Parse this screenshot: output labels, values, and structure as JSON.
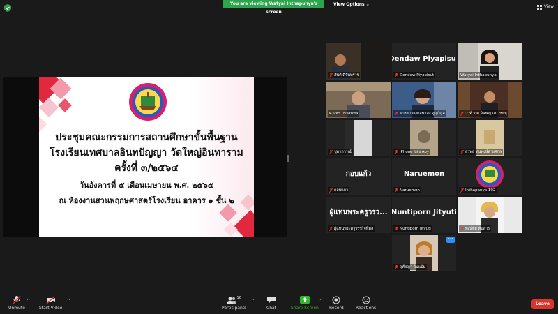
{
  "topbar": {
    "banner": "You are viewing Watyai Inthapunya's screen",
    "view_options": "View Options",
    "view": "View"
  },
  "slide": {
    "line1": "ประชุมคณะกรรมการสถานศึกษาขั้นพื้นฐาน",
    "line2": "โรงเรียนเทศบาลอินทปัญญา วัดใหญ่อินทาราม",
    "line3": "ครั้งที่  ๓/๒๕๖๔",
    "line4": "วันอังคารที่ ๕ เดือนเมษายน พ.ศ. ๒๕๖๕",
    "line5": "ณ ห้องงานสวนพฤกษศาสตร์โรงเรียน อาคาร ๑ ชั้น ๒"
  },
  "participants": [
    {
      "label": "สันติ ดีจันทร์ไร",
      "big": ""
    },
    {
      "label": "Dendaw Piyapisut",
      "big": "Dendaw Piyapisut"
    },
    {
      "label": "Watyai Inthapunya",
      "big": ""
    },
    {
      "label": "ดวงพร กราสนทพ",
      "big": ""
    },
    {
      "label": "นางสาวจงกลนาสะ สูญวิภูล",
      "big": ""
    },
    {
      "label": "ว่าที่ ร.ต.ดิษพญ แนวชยมุ",
      "big": ""
    },
    {
      "label": "ชุดาการณ์",
      "big": ""
    },
    {
      "label": "iPhone ของ Aoy",
      "big": ""
    },
    {
      "label": "สุรพล ทนพงษ์สายศกุล",
      "big": ""
    },
    {
      "label": "กอบแก้ว",
      "big": "กอบแก้ว"
    },
    {
      "label": "Naruemon",
      "big": "Naruemon"
    },
    {
      "label": "Inthapanya 102",
      "big": ""
    },
    {
      "label": "ผู้แทนพระครูรรรกิจพิมล",
      "big": "ผู้แทนพระครูวรว..."
    },
    {
      "label": "Nuntiporn Jityuti",
      "big": "Nuntiporn Jityuti"
    },
    {
      "label": "พงษ์ทัย ทับสาร",
      "big": ""
    },
    {
      "label": "ฤทัยญา อิ่มแม้ม",
      "big": ""
    }
  ],
  "toolbar": {
    "unmute": "Unmute",
    "start_video": "Start Video",
    "participants": "Participants",
    "participants_count": "16",
    "chat": "Chat",
    "share_screen": "Share Screen",
    "record": "Record",
    "reactions": "Reactions",
    "leave": "Leave"
  },
  "colors": {
    "banner_green": "#2da44e",
    "share_green": "#2eb82e",
    "leave_red": "#d9362b",
    "slide_red": "#e0283f",
    "active_border": "#b9e07a"
  }
}
